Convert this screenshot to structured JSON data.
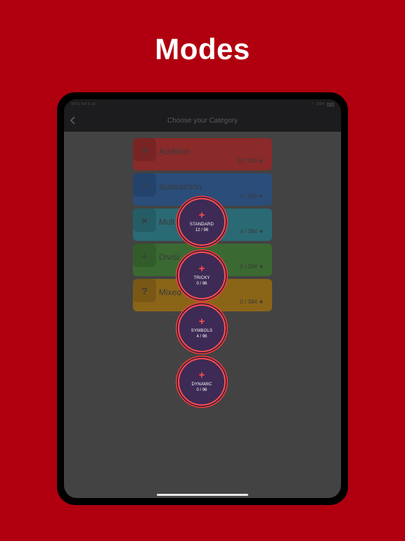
{
  "banner": {
    "title": "Modes"
  },
  "colors": {
    "background": "#b0000f",
    "addition": "#8a2a2a",
    "subtraction": "#2a4d7a",
    "multiplication": "#2a6a74",
    "division": "#3a6a32",
    "mixed": "#8a6518",
    "mode_button": "#3d2a55",
    "mode_ring": "#ff4f4f"
  },
  "status": {
    "time": "09:41",
    "date": "Tue 9 Jan",
    "battery": "100%"
  },
  "nav": {
    "title": "Choose your Category",
    "back_icon": "chevron-left-icon"
  },
  "categories": [
    {
      "symbol": "+",
      "name": "Addition",
      "score": "30 / 384 ★"
    },
    {
      "symbol": "−",
      "name": "Subtraction",
      "score": "0 / 384 ★"
    },
    {
      "symbol": "×",
      "name": "Mult",
      "score": "4 / 384 ★"
    },
    {
      "symbol": "÷",
      "name": "Divisi",
      "score": "0 / 384 ★"
    },
    {
      "symbol": "?",
      "name": "Mixed",
      "score": "0 / 384 ★"
    }
  ],
  "modes": [
    {
      "icon": "+",
      "label": "STANDARD",
      "count": "12 / 96"
    },
    {
      "icon": "+",
      "label": "TRICKY",
      "count": "0 / 96"
    },
    {
      "icon": "+",
      "label": "SYMBOLS",
      "count": "4 / 96"
    },
    {
      "icon": "+",
      "label": "DYNAMIC",
      "count": "0 / 96"
    }
  ]
}
